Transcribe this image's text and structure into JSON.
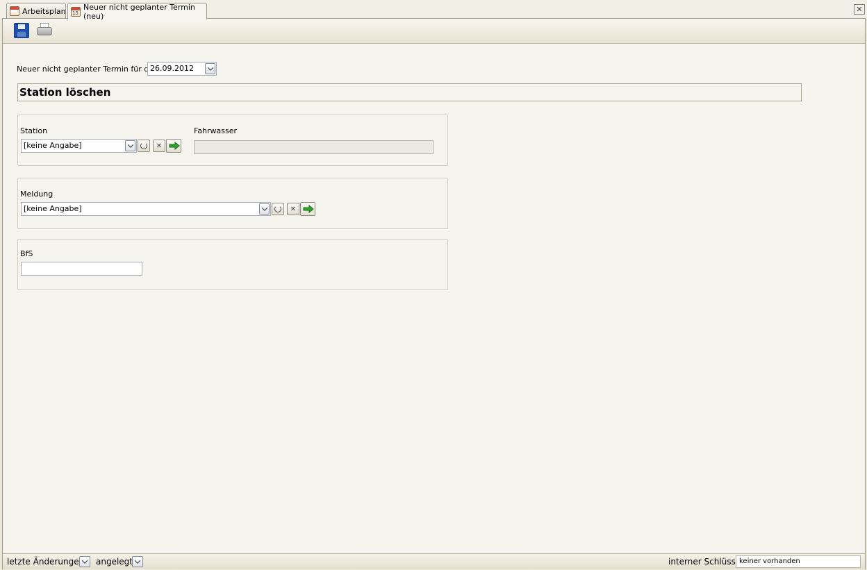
{
  "tabs": [
    {
      "label": "Arbeitsplan",
      "icon": "calendar-icon",
      "active": false
    },
    {
      "label": "Neuer nicht geplanter Termin (neu)",
      "icon": "calendar-15-icon",
      "active": true
    }
  ],
  "toolbar": {
    "save_icon": "floppy-disk-icon",
    "print_icon": "printer-icon"
  },
  "form": {
    "date_label": "Neuer nicht geplanter Termin für den",
    "date_value": "26.09.2012",
    "title": "Station löschen",
    "station": {
      "label": "Station",
      "value": "[keine Angabe]"
    },
    "fahrwasser": {
      "label": "Fahrwasser",
      "value": ""
    },
    "meldung": {
      "label": "Meldung",
      "value": "[keine Angabe]"
    },
    "bfs": {
      "label": "BfS",
      "value": ""
    }
  },
  "statusbar": {
    "last_changes_label": "letzte Änderungen",
    "created_label": "angelegt",
    "internal_key_label": "interner Schlüssel",
    "internal_key_value": "keiner vorhanden"
  },
  "colors": {
    "background": "#f6f4ef",
    "toolbar": "#e7e2d2",
    "go_arrow": "#2fa52f"
  }
}
